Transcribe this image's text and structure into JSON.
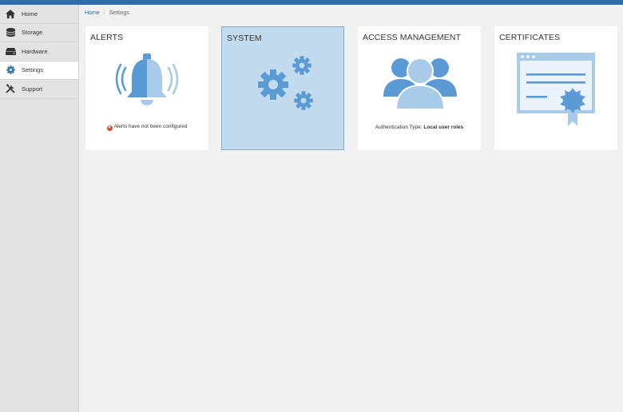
{
  "sidebar": {
    "items": [
      {
        "label": "Home",
        "icon": "home-icon"
      },
      {
        "label": "Storage",
        "icon": "storage-icon"
      },
      {
        "label": "Hardware",
        "icon": "hardware-icon"
      },
      {
        "label": "Settings",
        "icon": "gear-icon",
        "active": true
      },
      {
        "label": "Support",
        "icon": "tools-icon"
      }
    ]
  },
  "breadcrumb": {
    "home": "Home",
    "current": "Settings"
  },
  "cards": {
    "alerts": {
      "title": "ALERTS",
      "status_text": "Alerts have not been configured",
      "status_icon": "error-icon"
    },
    "system": {
      "title": "SYSTEM",
      "selected": true
    },
    "access": {
      "title": "ACCESS MANAGEMENT",
      "auth_label": "Authentication Type:",
      "auth_value": "Local user roles"
    },
    "certificates": {
      "title": "CERTIFICATES"
    }
  },
  "colors": {
    "accent": "#2d6da8",
    "illustration_blue": "#5b9bd5",
    "illustration_light": "#a8cbea",
    "selected_card": "#c3dbef",
    "error": "#d9453b"
  }
}
